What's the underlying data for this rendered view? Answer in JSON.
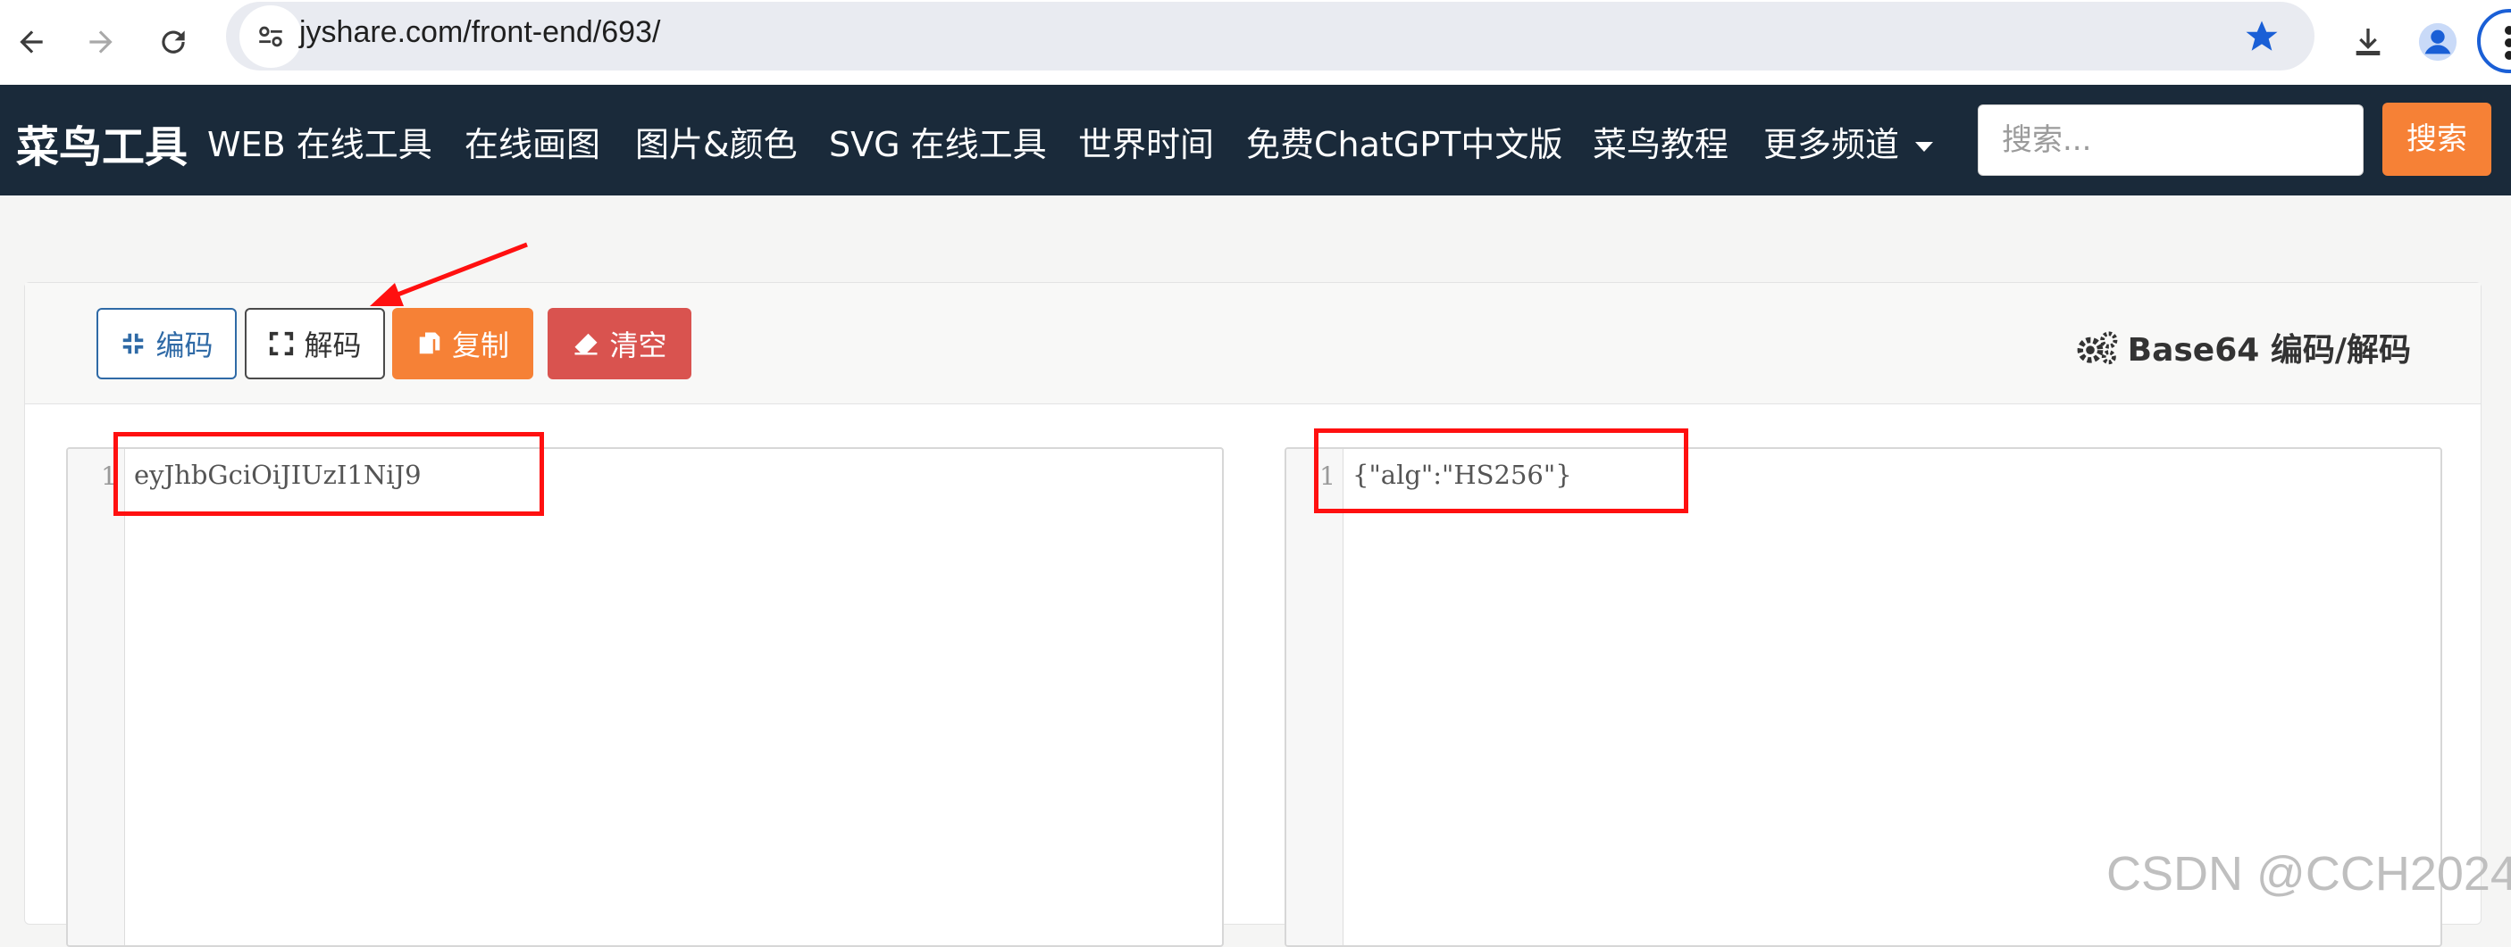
{
  "browser": {
    "url": "jyshare.com/front-end/693/"
  },
  "navbar": {
    "brand": "菜鸟工具",
    "items": [
      {
        "label": "WEB 在线工具"
      },
      {
        "label": "在线画图"
      },
      {
        "label": "图片&颜色"
      },
      {
        "label": "SVG 在线工具"
      },
      {
        "label": "世界时间"
      },
      {
        "label": "免费ChatGPT中文版"
      },
      {
        "label": "菜鸟教程"
      },
      {
        "label": "更多频道"
      }
    ],
    "search_placeholder": "搜索...",
    "search_button": "搜索"
  },
  "toolbar": {
    "encode_label": "编码",
    "decode_label": "解码",
    "copy_label": "复制",
    "clear_label": "清空",
    "title": "Base64 编码/解码"
  },
  "editors": {
    "input": {
      "line_number": "1",
      "text": "eyJhbGciOiJIUzI1NiJ9"
    },
    "output": {
      "line_number": "1",
      "text": "{\"alg\":\"HS256\"}"
    }
  },
  "watermark": "CSDN @CCH2024",
  "colors": {
    "navbar_bg": "#1a2a3a",
    "accent_orange": "#f68136",
    "danger_red": "#d9534f",
    "annotation_red": "#ff1010"
  }
}
